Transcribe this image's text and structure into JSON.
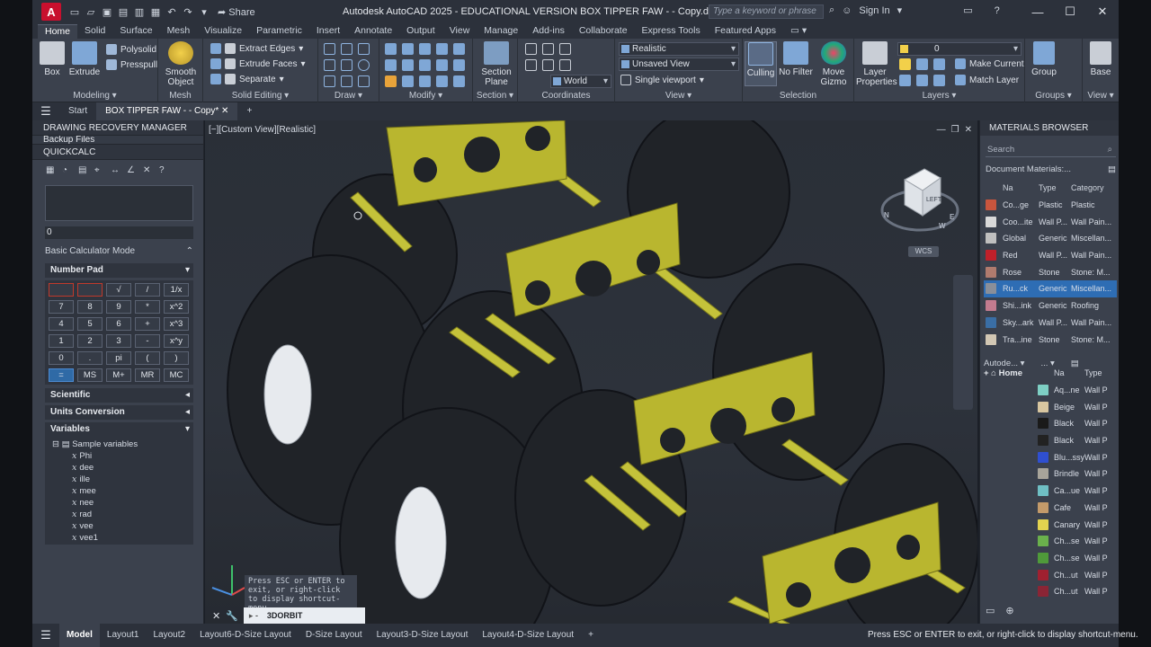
{
  "window": {
    "title": "Autodesk AutoCAD 2025 - EDUCATIONAL VERSION    BOX TIPPER FAW - - Copy.dwg",
    "app_logo": "A",
    "share_label": "Share",
    "search_placeholder": "Type a keyword or phrase",
    "signin_label": "Sign In"
  },
  "ribbon_tabs": [
    "Home",
    "Solid",
    "Surface",
    "Mesh",
    "Visualize",
    "Parametric",
    "Insert",
    "Annotate",
    "Output",
    "View",
    "Manage",
    "Add-ins",
    "Collaborate",
    "Express Tools",
    "Featured Apps"
  ],
  "ribbon": {
    "modeling": {
      "label": "Modeling",
      "box": "Box",
      "extrude": "Extrude",
      "polysolid": "Polysolid",
      "presspull": "Presspull"
    },
    "mesh": {
      "label": "Mesh",
      "smooth_object": "Smooth Object"
    },
    "solid_editing": {
      "label": "Solid Editing",
      "extract_edges": "Extract Edges",
      "extrude_faces": "Extrude Faces",
      "separate": "Separate"
    },
    "draw": {
      "label": "Draw"
    },
    "modify": {
      "label": "Modify"
    },
    "section": {
      "label": "Section",
      "section_plane": "Section Plane"
    },
    "coordinates": {
      "label": "Coordinates",
      "world": "World"
    },
    "view": {
      "label": "View",
      "visual_style": "Realistic",
      "saved_view": "Unsaved View",
      "viewport": "Single viewport"
    },
    "selection": {
      "label": "Selection",
      "culling": "Culling",
      "no_filter": "No Filter",
      "move_gizmo": "Move Gizmo"
    },
    "layers": {
      "label": "Layers",
      "layer_properties": "Layer Properties",
      "layer_value": "0",
      "make_current": "Make Current",
      "match_layer": "Match Layer"
    },
    "groups": {
      "label": "Groups",
      "group": "Group"
    },
    "view2": {
      "label": "View",
      "base": "Base"
    }
  },
  "file_tabs": {
    "start": "Start",
    "active": "BOX TIPPER FAW - - Copy*"
  },
  "left_panel": {
    "recovery_title": "DRAWING RECOVERY MANAGER",
    "backup_files": "Backup Files",
    "quickcalc_title": "QUICKCALC",
    "input_value": "0",
    "mode_label": "Basic Calculator Mode",
    "number_pad": "Number Pad",
    "keys": [
      "",
      "",
      "√",
      "/",
      "1/x",
      "7",
      "8",
      "9",
      "*",
      "x^2",
      "4",
      "5",
      "6",
      "+",
      "x^3",
      "1",
      "2",
      "3",
      "-",
      "x^y",
      "0",
      ".",
      "pi",
      "(",
      ")",
      "=",
      "MS",
      "M+",
      "MR",
      "MC"
    ],
    "scientific": "Scientific",
    "units_conversion": "Units Conversion",
    "variables": "Variables",
    "sample_variables": "Sample variables",
    "var_list": [
      "Phi",
      "dee",
      "ille",
      "mee",
      "nee",
      "rad",
      "vee",
      "vee1"
    ]
  },
  "viewport": {
    "label": "[−][Custom View][Realistic]",
    "viewcube_face": "LEFT",
    "compass": {
      "n": "N",
      "w": "W",
      "e": "E"
    },
    "wcs": "WCS",
    "tooltip": "Press ESC or ENTER to exit, or right-click to display shortcut-menu.",
    "command": "3DORBIT"
  },
  "materials": {
    "title": "MATERIALS BROWSER",
    "search_placeholder": "Search",
    "doc_materials": "Document Materials:...",
    "headers": [
      "Na",
      "Type",
      "Category"
    ],
    "rows": [
      {
        "name": "Co...ge",
        "type": "Plastic",
        "category": "Plastic",
        "color": "#c8553d"
      },
      {
        "name": "Coo...ite",
        "type": "Wall P...",
        "category": "Wall Pain...",
        "color": "#d9d9d9"
      },
      {
        "name": "Global",
        "type": "Generic",
        "category": "Miscellan...",
        "color": "#bfbfbf"
      },
      {
        "name": "Red",
        "type": "Wall P...",
        "category": "Wall Pain...",
        "color": "#c0202a"
      },
      {
        "name": "Rose",
        "type": "Stone",
        "category": "Stone: M...",
        "color": "#b07b6e"
      },
      {
        "name": "Ru...ck",
        "type": "Generic",
        "category": "Miscellan...",
        "color": "#8a8f99"
      },
      {
        "name": "Shi...ink",
        "type": "Generic",
        "category": "Roofing",
        "color": "#c37b8f"
      },
      {
        "name": "Sky...ark",
        "type": "Wall P...",
        "category": "Wall Pain...",
        "color": "#3a6ea5"
      },
      {
        "name": "Tra...ine",
        "type": "Stone",
        "category": "Stone: M...",
        "color": "#d2c7b4"
      }
    ],
    "selected_index": 5,
    "library_label": "Autode...",
    "library_more": "...",
    "home": "Home",
    "lib_headers": [
      "Na",
      "Type"
    ],
    "lib_rows": [
      {
        "name": "Aq...ne",
        "type": "Wall P",
        "color": "#7ecfc4"
      },
      {
        "name": "Beige",
        "type": "Wall P",
        "color": "#d8c6a0"
      },
      {
        "name": "Black",
        "type": "Wall P",
        "color": "#1a1a1a"
      },
      {
        "name": "Black",
        "type": "Wall P",
        "color": "#222222"
      },
      {
        "name": "Blu...ssy",
        "type": "Wall P",
        "color": "#2f4fd0"
      },
      {
        "name": "Brindle",
        "type": "Wall P",
        "color": "#a8a49a"
      },
      {
        "name": "Ca...ue",
        "type": "Wall P",
        "color": "#6fbfc4"
      },
      {
        "name": "Cafe",
        "type": "Wall P",
        "color": "#c39a6a"
      },
      {
        "name": "Canary",
        "type": "Wall P",
        "color": "#e3d34f"
      },
      {
        "name": "Ch...se",
        "type": "Wall P",
        "color": "#6ab04c"
      },
      {
        "name": "Ch...se",
        "type": "Wall P",
        "color": "#4f9a3a"
      },
      {
        "name": "Ch...ut",
        "type": "Wall P",
        "color": "#a02030"
      },
      {
        "name": "Ch...ut",
        "type": "Wall P",
        "color": "#8a2535"
      }
    ]
  },
  "status": {
    "tabs": [
      "Model",
      "Layout1",
      "Layout2",
      "Layout6-D-Size Layout",
      "D-Size Layout",
      "Layout3-D-Size Layout",
      "Layout4-D-Size Layout"
    ],
    "message": "Press ESC or ENTER to exit, or right-click to display shortcut-menu."
  }
}
